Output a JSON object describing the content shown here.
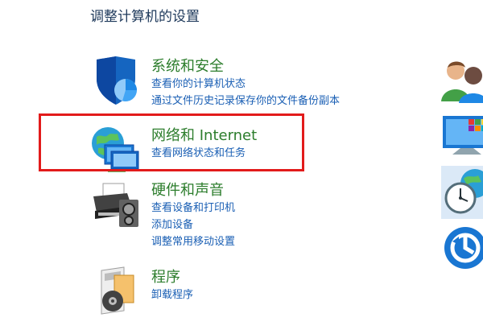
{
  "page": {
    "title": "调整计算机的设置"
  },
  "categories": [
    {
      "title": "系统和安全",
      "icon": "shield-icon",
      "links": [
        "查看你的计算机状态",
        "通过文件历史记录保存你的文件备份副本"
      ]
    },
    {
      "title": "网络和 Internet",
      "icon": "network-globe-icon",
      "links": [
        "查看网络状态和任务"
      ]
    },
    {
      "title": "硬件和声音",
      "icon": "printer-icon",
      "links": [
        "查看设备和打印机",
        "添加设备",
        "调整常用移动设置"
      ]
    },
    {
      "title": "程序",
      "icon": "programs-icon",
      "links": [
        "卸载程序"
      ]
    }
  ],
  "right_icons": [
    "user-accounts-icon",
    "appearance-icon",
    "clock-globe-icon",
    "ease-of-access-icon"
  ],
  "colors": {
    "category_title": "#2c7d2c",
    "link": "#1a5fb4",
    "page_title": "#1e395b",
    "highlight": "#e21b1b"
  }
}
